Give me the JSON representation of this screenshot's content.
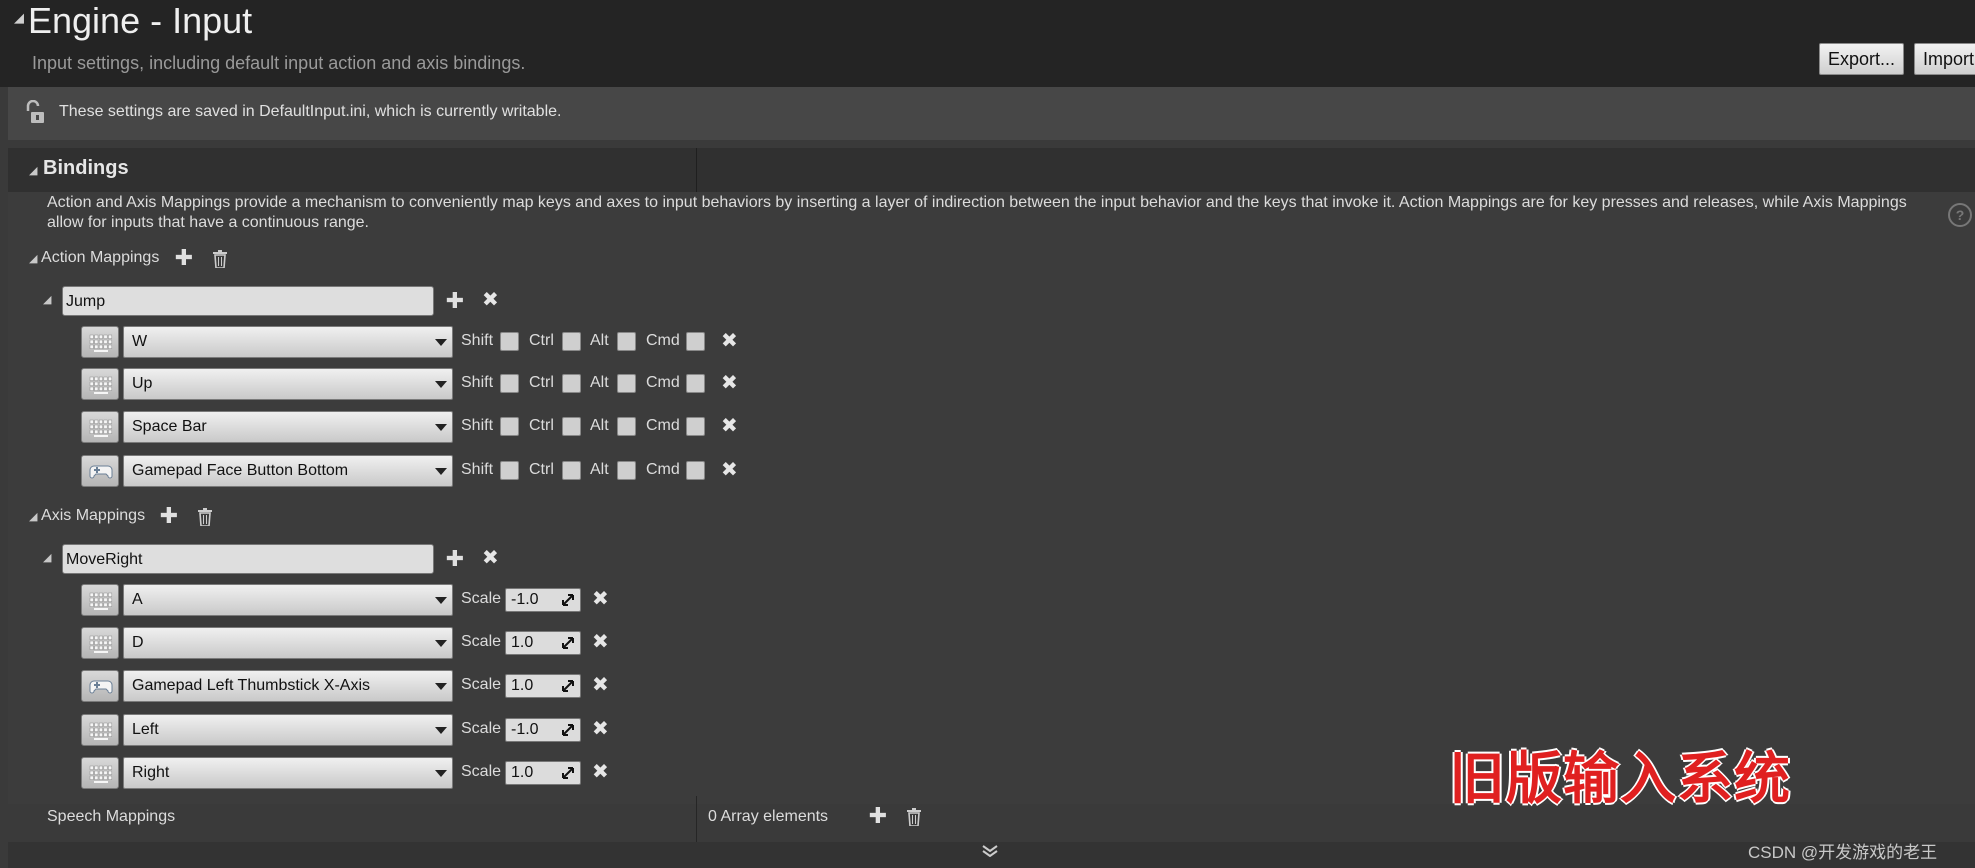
{
  "header": {
    "title": "Engine - Input",
    "subtitle": "Input settings, including default input action and axis bindings.",
    "export_label": "Export...",
    "import_label": "Import"
  },
  "info": {
    "text": "These settings are saved in DefaultInput.ini, which is currently writable."
  },
  "bindings": {
    "title": "Bindings",
    "description": "Action and Axis Mappings provide a mechanism to conveniently map keys and axes to input behaviors by inserting a layer of indirection between the input behavior and the keys that invoke it. Action Mappings are for key presses and releases, while Axis Mappings allow for inputs that have a continuous range."
  },
  "action_mappings": {
    "label": "Action Mappings",
    "name": "Jump",
    "modifiers": [
      "Shift",
      "Ctrl",
      "Alt",
      "Cmd"
    ],
    "keys": [
      {
        "key": "W",
        "device": "keyboard"
      },
      {
        "key": "Up",
        "device": "keyboard"
      },
      {
        "key": "Space Bar",
        "device": "keyboard"
      },
      {
        "key": "Gamepad Face Button Bottom",
        "device": "gamepad"
      }
    ]
  },
  "axis_mappings": {
    "label": "Axis Mappings",
    "name": "MoveRight",
    "scale_label": "Scale",
    "keys": [
      {
        "key": "A",
        "device": "keyboard",
        "scale": "-1.0"
      },
      {
        "key": "D",
        "device": "keyboard",
        "scale": "1.0"
      },
      {
        "key": "Gamepad Left Thumbstick X-Axis",
        "device": "gamepad",
        "scale": "1.0"
      },
      {
        "key": "Left",
        "device": "keyboard",
        "scale": "-1.0"
      },
      {
        "key": "Right",
        "device": "keyboard",
        "scale": "1.0"
      }
    ]
  },
  "speech_mappings": {
    "label": "Speech Mappings",
    "count_text": "0 Array elements"
  },
  "overlay": {
    "text": "旧版输入系统",
    "color": "#e02020"
  },
  "watermark": "CSDN @开发游戏的老王"
}
